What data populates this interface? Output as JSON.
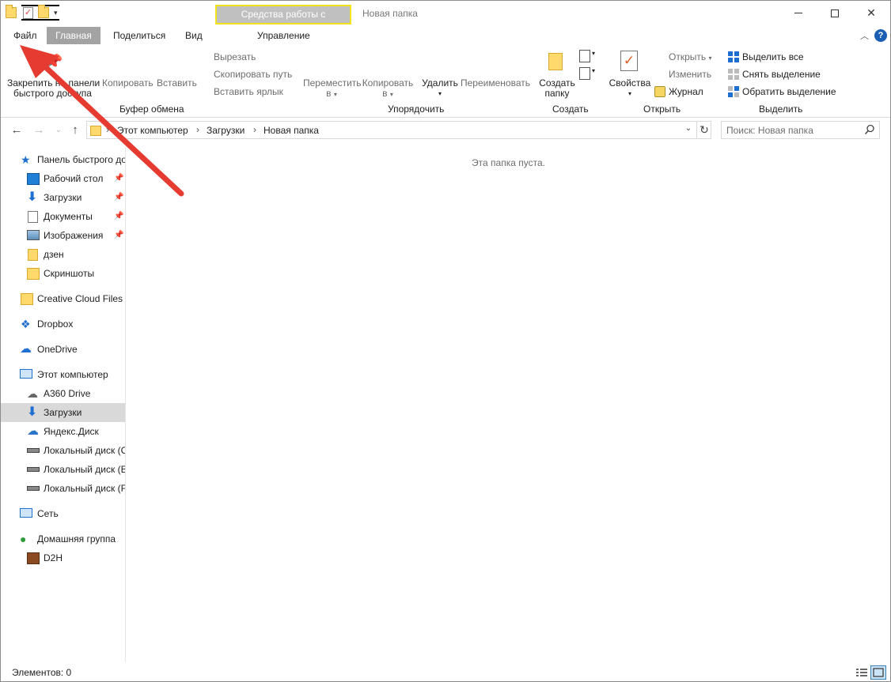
{
  "window": {
    "title": "Новая папка",
    "contextual_tab": "Средства работы с рисунками"
  },
  "ribbon_tabs": {
    "file": "Файл",
    "home": "Главная",
    "share": "Поделиться",
    "view": "Вид",
    "manage": "Управление"
  },
  "ribbon": {
    "clipboard": {
      "pin_label_1": "Закрепить на панели",
      "pin_label_2": "быстрого доступа",
      "copy": "Копировать",
      "paste": "Вставить",
      "cut": "Вырезать",
      "copy_path": "Скопировать путь",
      "paste_shortcut": "Вставить ярлык",
      "group": "Буфер обмена"
    },
    "organize": {
      "move_to_1": "Переместить",
      "move_to_2": "в",
      "copy_to_1": "Копировать",
      "copy_to_2": "в",
      "delete": "Удалить",
      "rename": "Переименовать",
      "group": "Упорядочить"
    },
    "new": {
      "new_folder_1": "Создать",
      "new_folder_2": "папку",
      "group": "Создать"
    },
    "open": {
      "properties": "Свойства",
      "open": "Открыть",
      "edit": "Изменить",
      "history": "Журнал",
      "group": "Открыть"
    },
    "select": {
      "select_all": "Выделить все",
      "select_none": "Снять выделение",
      "invert": "Обратить выделение",
      "group": "Выделить"
    }
  },
  "address": {
    "crumbs": [
      "Этот компьютер",
      "Загрузки",
      "Новая папка"
    ],
    "search_placeholder": "Поиск: Новая папка"
  },
  "nav": {
    "quick_access": "Панель быстрого доступа",
    "items": [
      {
        "label": "Рабочий стол",
        "icon": "desktop-icon",
        "pinned": true
      },
      {
        "label": "Загрузки",
        "icon": "downloads-icon",
        "pinned": true
      },
      {
        "label": "Документы",
        "icon": "documents-icon",
        "pinned": true
      },
      {
        "label": "Изображения",
        "icon": "pictures-icon",
        "pinned": true
      },
      {
        "label": "дзен",
        "icon": "folder-icon",
        "pinned": false
      },
      {
        "label": "Скриншоты",
        "icon": "screenshots-folder-icon",
        "pinned": false
      }
    ],
    "creative_cloud": "Creative Cloud Files",
    "dropbox": "Dropbox",
    "onedrive": "OneDrive",
    "this_pc": "Этот компьютер",
    "pc_items": [
      {
        "label": "A360 Drive",
        "icon": "a360-icon"
      },
      {
        "label": "Загрузки",
        "icon": "downloads-icon",
        "selected": true
      },
      {
        "label": "Яндекс.Диск",
        "icon": "yandex-disk-icon"
      },
      {
        "label": "Локальный диск (C",
        "icon": "drive-icon"
      },
      {
        "label": "Локальный диск (E",
        "icon": "drive-icon"
      },
      {
        "label": "Локальный диск (F",
        "icon": "drive-icon"
      }
    ],
    "network": "Сеть",
    "homegroup": "Домашняя группа",
    "homegroup_user": "D2H"
  },
  "content": {
    "empty_message": "Эта папка пуста."
  },
  "status": {
    "items_count": "Элементов: 0"
  },
  "colors": {
    "accent_blue": "#1f6fd1",
    "active_tab": "#a3a3a3",
    "contextual_border": "#f2e31a",
    "annotation_arrow": "#e53b30",
    "selected_nav": "#d9d9d9"
  }
}
